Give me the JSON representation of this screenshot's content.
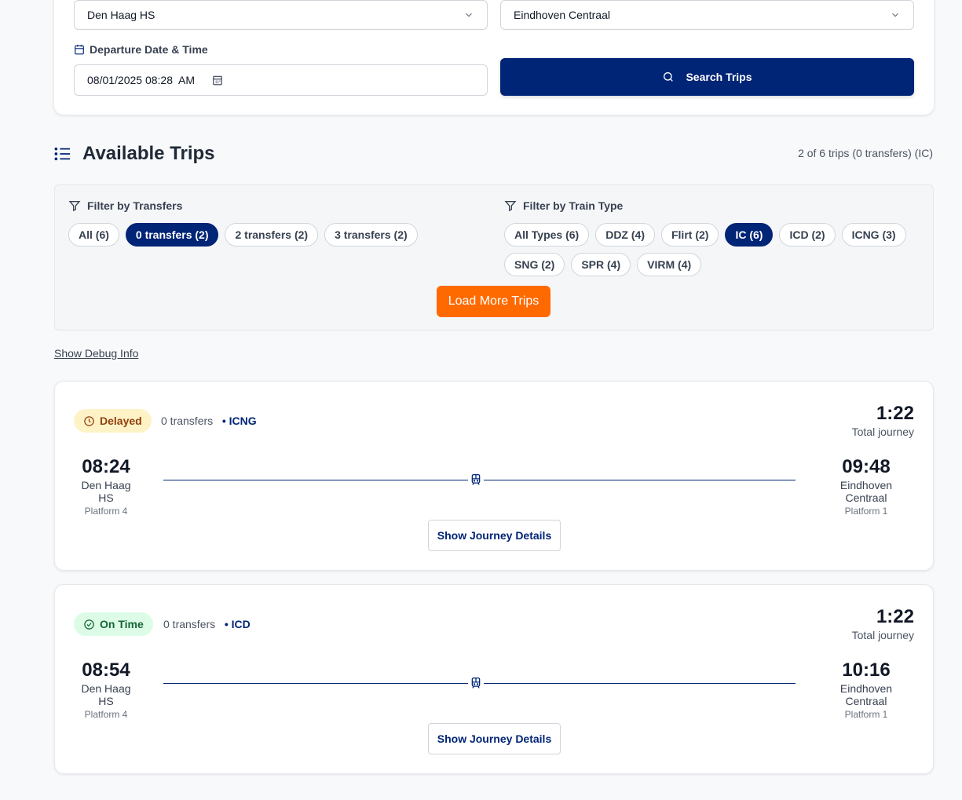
{
  "search": {
    "from_station": "Den Haag HS",
    "to_station": "Eindhoven Centraal",
    "datetime_label": "Departure Date & Time",
    "datetime_value": "08/01/2025 08:28  AM",
    "search_button": "Search Trips"
  },
  "results": {
    "title": "Available Trips",
    "count_text": "2 of 6 trips (0 transfers) (IC)"
  },
  "filters": {
    "transfers_label": "Filter by Transfers",
    "transfer_chips": [
      {
        "label": "All (6)",
        "active": false
      },
      {
        "label": "0 transfers (2)",
        "active": true
      },
      {
        "label": "2 transfers (2)",
        "active": false
      },
      {
        "label": "3 transfers (2)",
        "active": false
      }
    ],
    "train_type_label": "Filter by Train Type",
    "train_type_chips": [
      {
        "label": "All Types (6)",
        "active": false
      },
      {
        "label": "DDZ (4)",
        "active": false
      },
      {
        "label": "Flirt (2)",
        "active": false
      },
      {
        "label": "IC (6)",
        "active": true
      },
      {
        "label": "ICD (2)",
        "active": false
      },
      {
        "label": "ICNG (3)",
        "active": false
      },
      {
        "label": "SNG (2)",
        "active": false
      },
      {
        "label": "SPR (4)",
        "active": false
      },
      {
        "label": "VIRM (4)",
        "active": false
      }
    ],
    "load_more": "Load More Trips"
  },
  "debug_link": "Show Debug Info",
  "trips": [
    {
      "status": "Delayed",
      "transfers": "0 transfers",
      "train_type": "• ICNG",
      "duration": "1:22",
      "duration_label": "Total journey",
      "depart_time": "08:24",
      "depart_station": "Den Haag HS",
      "depart_platform": "Platform 4",
      "arrive_time": "09:48",
      "arrive_station": "Eindhoven Centraal",
      "arrive_platform": "Platform 1",
      "details_button": "Show Journey Details"
    },
    {
      "status": "On Time",
      "transfers": "0 transfers",
      "train_type": "• ICD",
      "duration": "1:22",
      "duration_label": "Total journey",
      "depart_time": "08:54",
      "depart_station": "Den Haag HS",
      "depart_platform": "Platform 4",
      "arrive_time": "10:16",
      "arrive_station": "Eindhoven Centraal",
      "arrive_platform": "Platform 1",
      "details_button": "Show Journey Details"
    }
  ],
  "colors": {
    "primary": "#002476",
    "accent": "#ff6a00",
    "delayed_bg": "#fef3c7",
    "ontime_bg": "#dcfce7"
  }
}
